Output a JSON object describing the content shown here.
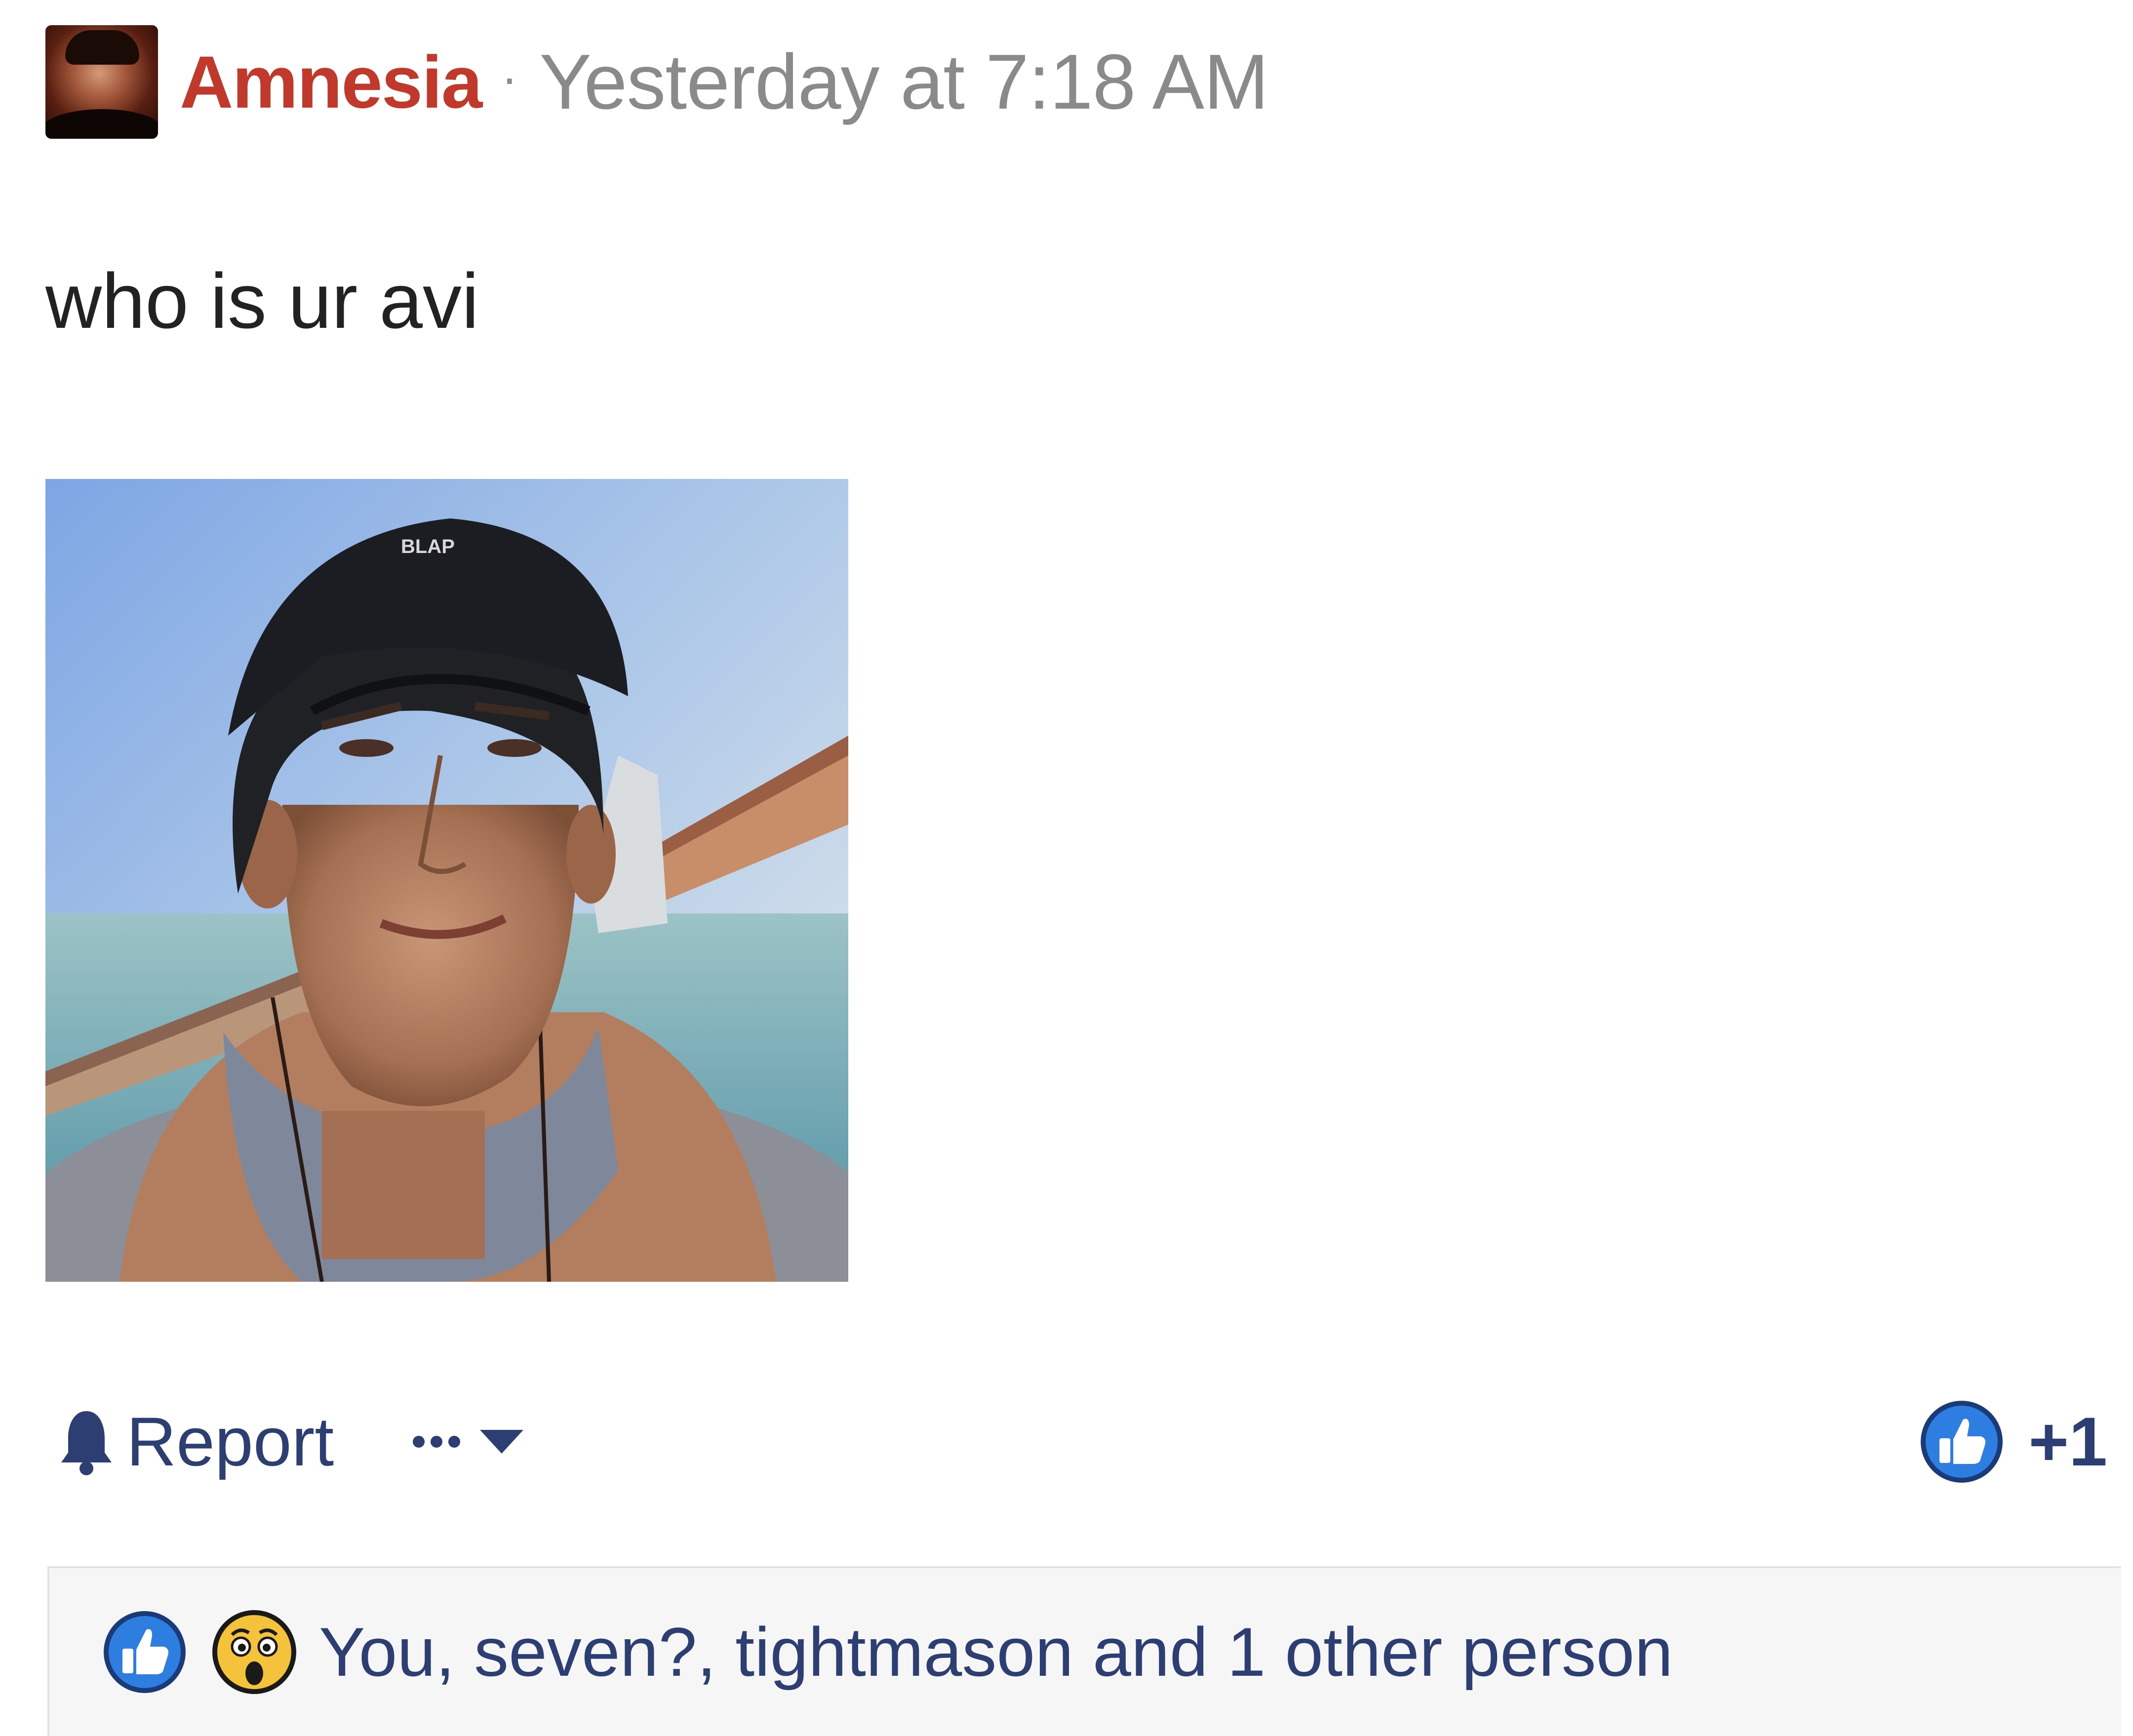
{
  "post": {
    "author": "Amnesia",
    "separator": "·",
    "timestamp": "Yesterday at 7:18 AM",
    "text": "who is ur avi"
  },
  "actions": {
    "report_label": "Report",
    "like_count": "+1"
  },
  "reactions": {
    "summary": "You, seven?, tightmason and 1 other person",
    "icons": [
      "like-icon",
      "wow-icon"
    ]
  },
  "photo": {
    "cap_text": "BLAP"
  },
  "colors": {
    "author": "#c0392b",
    "timestamp": "#8a8a8a",
    "accent": "#2c3e72",
    "like_blue": "#2e7de0",
    "wow_yellow": "#f5c33b",
    "reaction_bg": "#f6f6f7"
  }
}
